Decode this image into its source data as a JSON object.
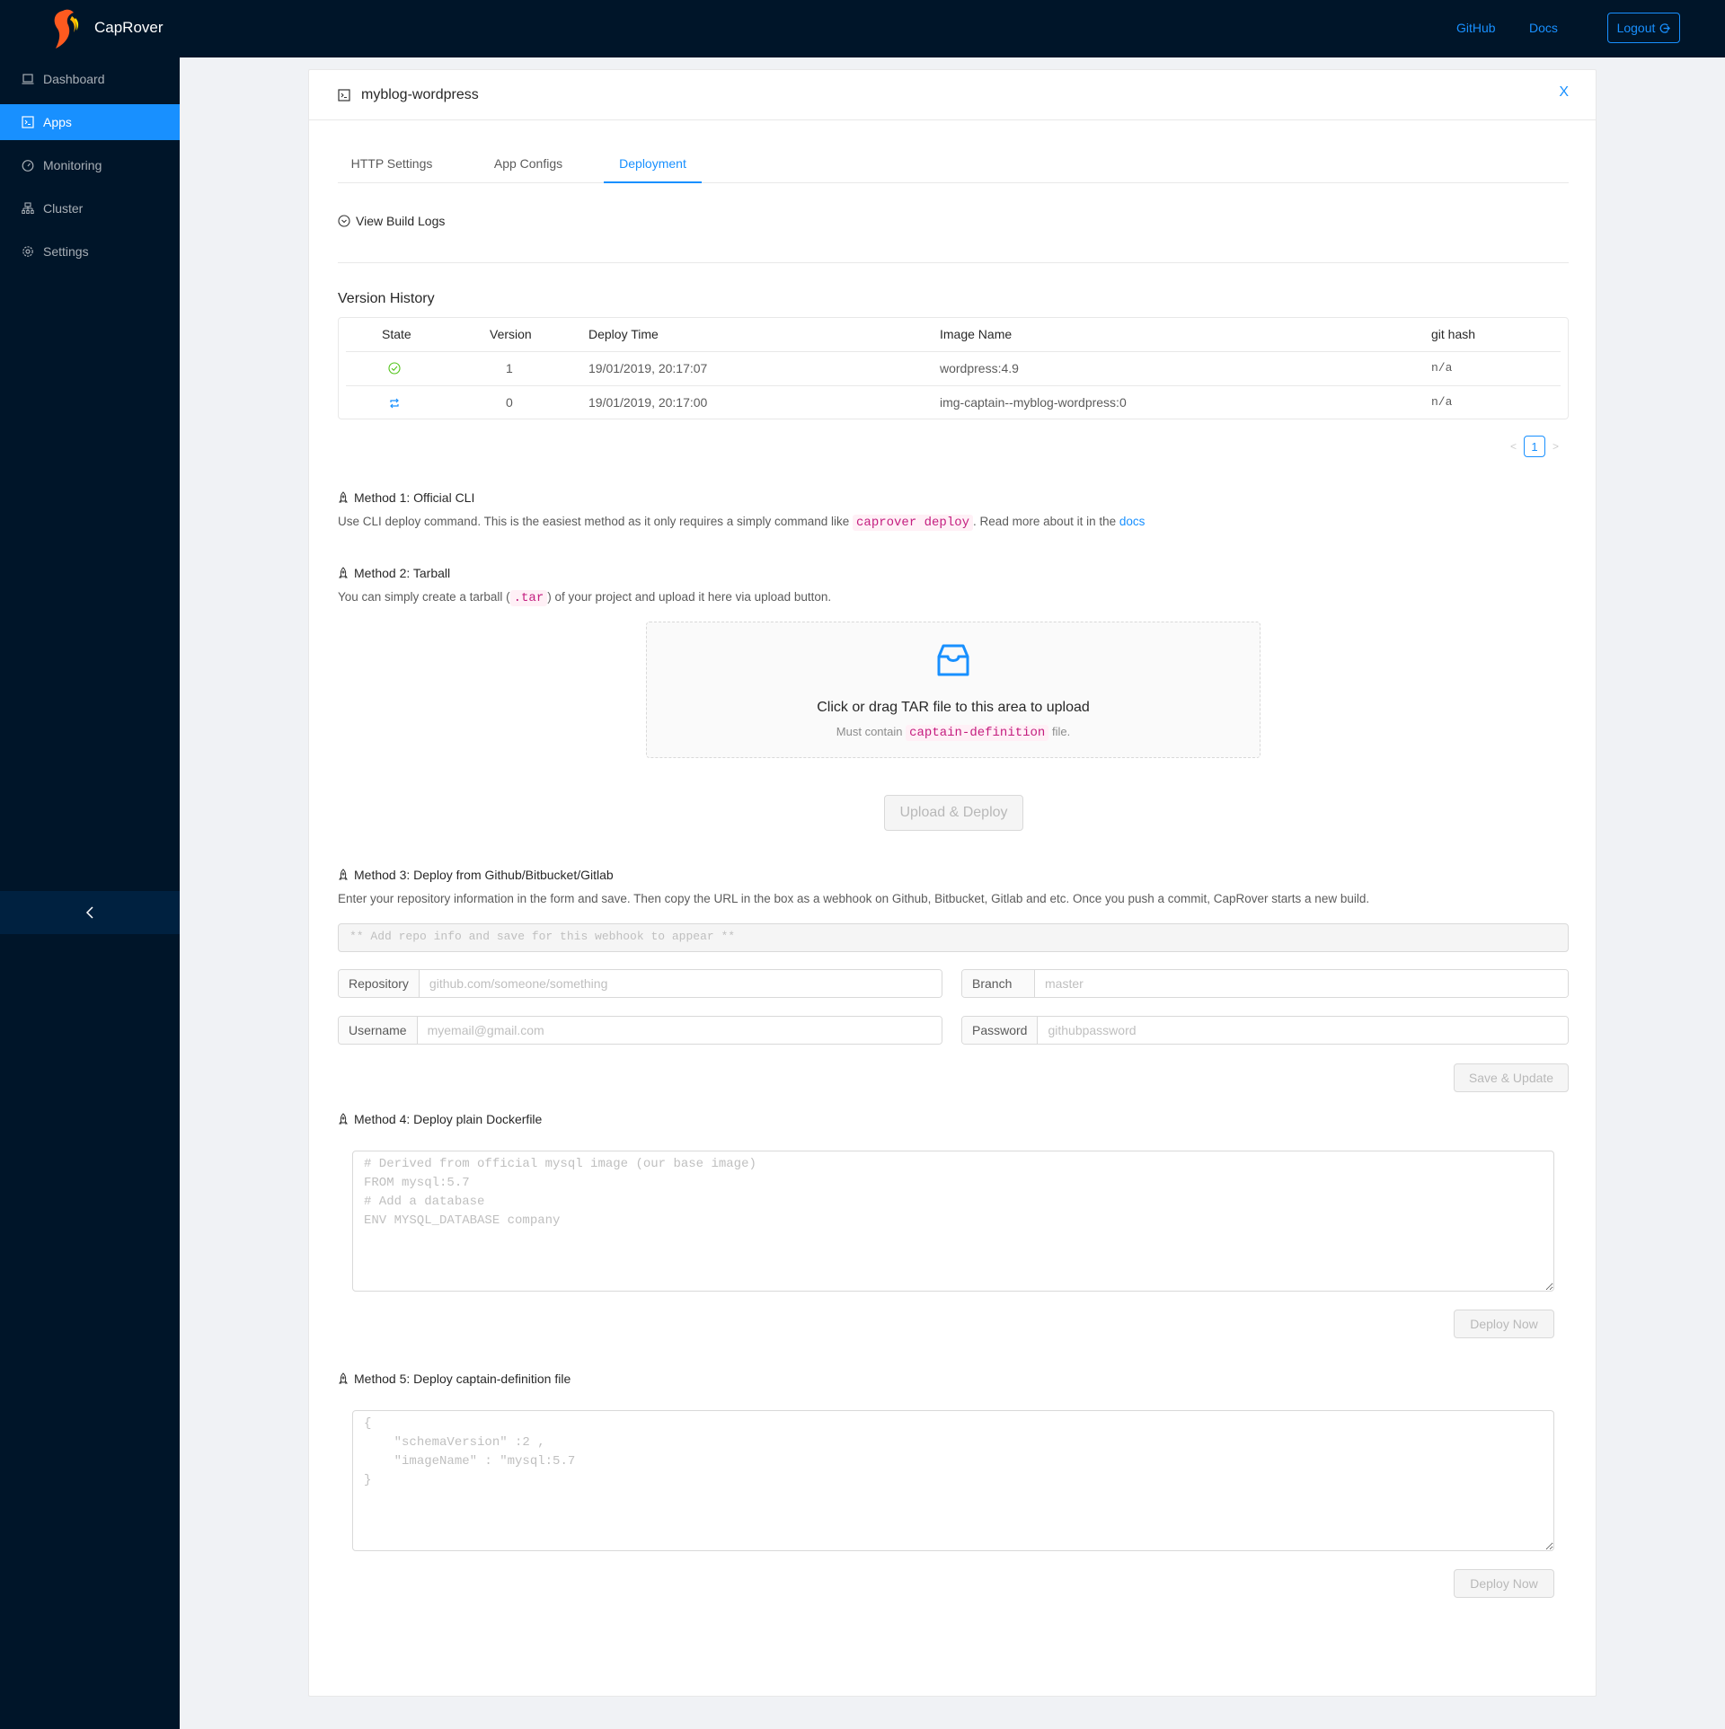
{
  "header": {
    "brand": "CapRover",
    "links": [
      {
        "label": "GitHub"
      },
      {
        "label": "Docs"
      }
    ],
    "logout_label": "Logout",
    "accent": "#1890ff",
    "bg": "#001529"
  },
  "sidebar": {
    "items": [
      {
        "label": "Dashboard",
        "icon": "laptop-icon",
        "active": false
      },
      {
        "label": "Apps",
        "icon": "code-terminal-icon",
        "active": true
      },
      {
        "label": "Monitoring",
        "icon": "dashboard-gauge-icon",
        "active": false
      },
      {
        "label": "Cluster",
        "icon": "cluster-icon",
        "active": false
      },
      {
        "label": "Settings",
        "icon": "gear-icon",
        "active": false
      }
    ],
    "collapse_icon": "chevron-left-icon"
  },
  "app": {
    "title": "myblog-wordpress",
    "close_label": "X",
    "tabs": [
      {
        "label": "HTTP Settings",
        "active": false
      },
      {
        "label": "App Configs",
        "active": false
      },
      {
        "label": "Deployment",
        "active": true
      }
    ]
  },
  "deployment": {
    "build_logs_label": "View Build Logs",
    "version_history": {
      "title": "Version History",
      "columns": [
        "State",
        "Version",
        "Deploy Time",
        "Image Name",
        "git hash"
      ],
      "rows": [
        {
          "state": "success",
          "state_icon": "check-circle-icon",
          "version": "1",
          "deploy_time": "19/01/2019, 20:17:07",
          "image_name": "wordpress:4.9",
          "git_hash": "n/a"
        },
        {
          "state": "retry",
          "state_icon": "retweet-icon",
          "version": "0",
          "deploy_time": "19/01/2019, 20:17:00",
          "image_name": "img-captain--myblog-wordpress:0",
          "git_hash": "n/a"
        }
      ],
      "pagination": {
        "current_page": "1"
      }
    },
    "method1": {
      "title": "Method 1: Official CLI",
      "desc_before": "Use CLI deploy command. This is the easiest method as it only requires a simply command like",
      "code": "caprover deploy",
      "desc_after": ". Read more about it in the",
      "link": "docs"
    },
    "method2": {
      "title": "Method 2: Tarball",
      "desc_before": "You can simply create a tarball (",
      "code": ".tar",
      "desc_after": ") of your project and upload it here via upload button.",
      "dropzone_title": "Click or drag TAR file to this area to upload",
      "dropzone_hint_before": "Must contain",
      "dropzone_hint_code": "captain-definition",
      "dropzone_hint_after": "file.",
      "upload_button": "Upload & Deploy"
    },
    "method3": {
      "title": "Method 3: Deploy from Github/Bitbucket/Gitlab",
      "desc": "Enter your repository information in the form and save. Then copy the URL in the box as a webhook on Github, Bitbucket, Gitlab and etc. Once you push a commit, CapRover starts a new build.",
      "webhook_placeholder": "** Add repo info and save for this webhook to appear **",
      "fields": {
        "repository": {
          "label": "Repository",
          "placeholder": "github.com/someone/something",
          "value": ""
        },
        "branch": {
          "label": "Branch",
          "placeholder": "master",
          "value": ""
        },
        "username": {
          "label": "Username",
          "placeholder": "myemail@gmail.com",
          "value": ""
        },
        "password": {
          "label": "Password",
          "placeholder": "githubpassword",
          "value": ""
        }
      },
      "save_button": "Save & Update"
    },
    "method4": {
      "title": "Method 4: Deploy plain Dockerfile",
      "placeholder": "# Derived from official mysql image (our base image)\nFROM mysql:5.7\n# Add a database\nENV MYSQL_DATABASE company",
      "deploy_button": "Deploy Now"
    },
    "method5": {
      "title": "Method 5: Deploy captain-definition file",
      "placeholder": "{\n    \"schemaVersion\" :2 ,\n    \"imageName\" : \"mysql:5.7\n}",
      "deploy_button": "Deploy Now"
    }
  }
}
